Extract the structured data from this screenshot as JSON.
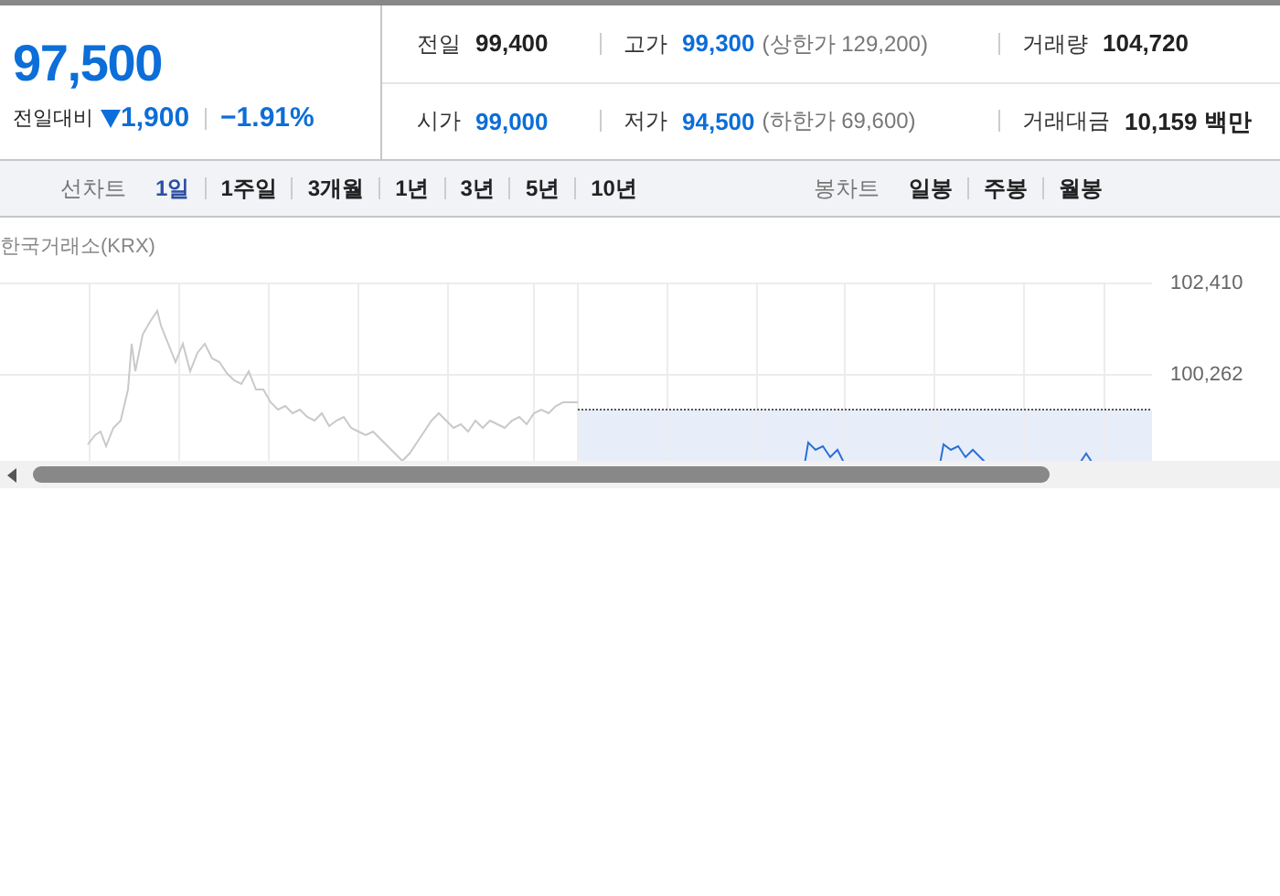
{
  "quote": {
    "price": "97,500",
    "change_label": "전일대비",
    "falling": true,
    "change": "1,900",
    "change_rate": "−1.91%"
  },
  "stats": [
    [
      {
        "label": "전일",
        "value": "99,400",
        "highlighted": false
      },
      {
        "label": "고가",
        "value": "99,300",
        "highlighted": true,
        "note": "(상한가 129,200)"
      },
      {
        "label": "거래량",
        "value": "104,720",
        "highlighted": false
      }
    ],
    [
      {
        "label": "시가",
        "value": "99,000",
        "highlighted": true
      },
      {
        "label": "저가",
        "value": "94,500",
        "highlighted": true,
        "note": "(하한가 69,600)"
      },
      {
        "label": "거래대금",
        "value": "10,159 백만",
        "highlighted": false
      }
    ]
  ],
  "line_chart_tabs": {
    "label": "선차트",
    "items": [
      {
        "label": "1일",
        "selected": true
      },
      {
        "label": "1주일",
        "selected": false
      },
      {
        "label": "3개월",
        "selected": false
      },
      {
        "label": "1년",
        "selected": false
      },
      {
        "label": "3년",
        "selected": false
      },
      {
        "label": "5년",
        "selected": false
      },
      {
        "label": "10년",
        "selected": false
      }
    ]
  },
  "candle_chart_tabs": {
    "label": "봉차트",
    "items": [
      {
        "label": "일봉",
        "selected": false
      },
      {
        "label": "주봉",
        "selected": false
      },
      {
        "label": "월봉",
        "selected": false
      }
    ]
  },
  "chart": {
    "source": "한국거래소(KRX)",
    "y_labels": [
      "102,410",
      "100,262"
    ]
  }
}
